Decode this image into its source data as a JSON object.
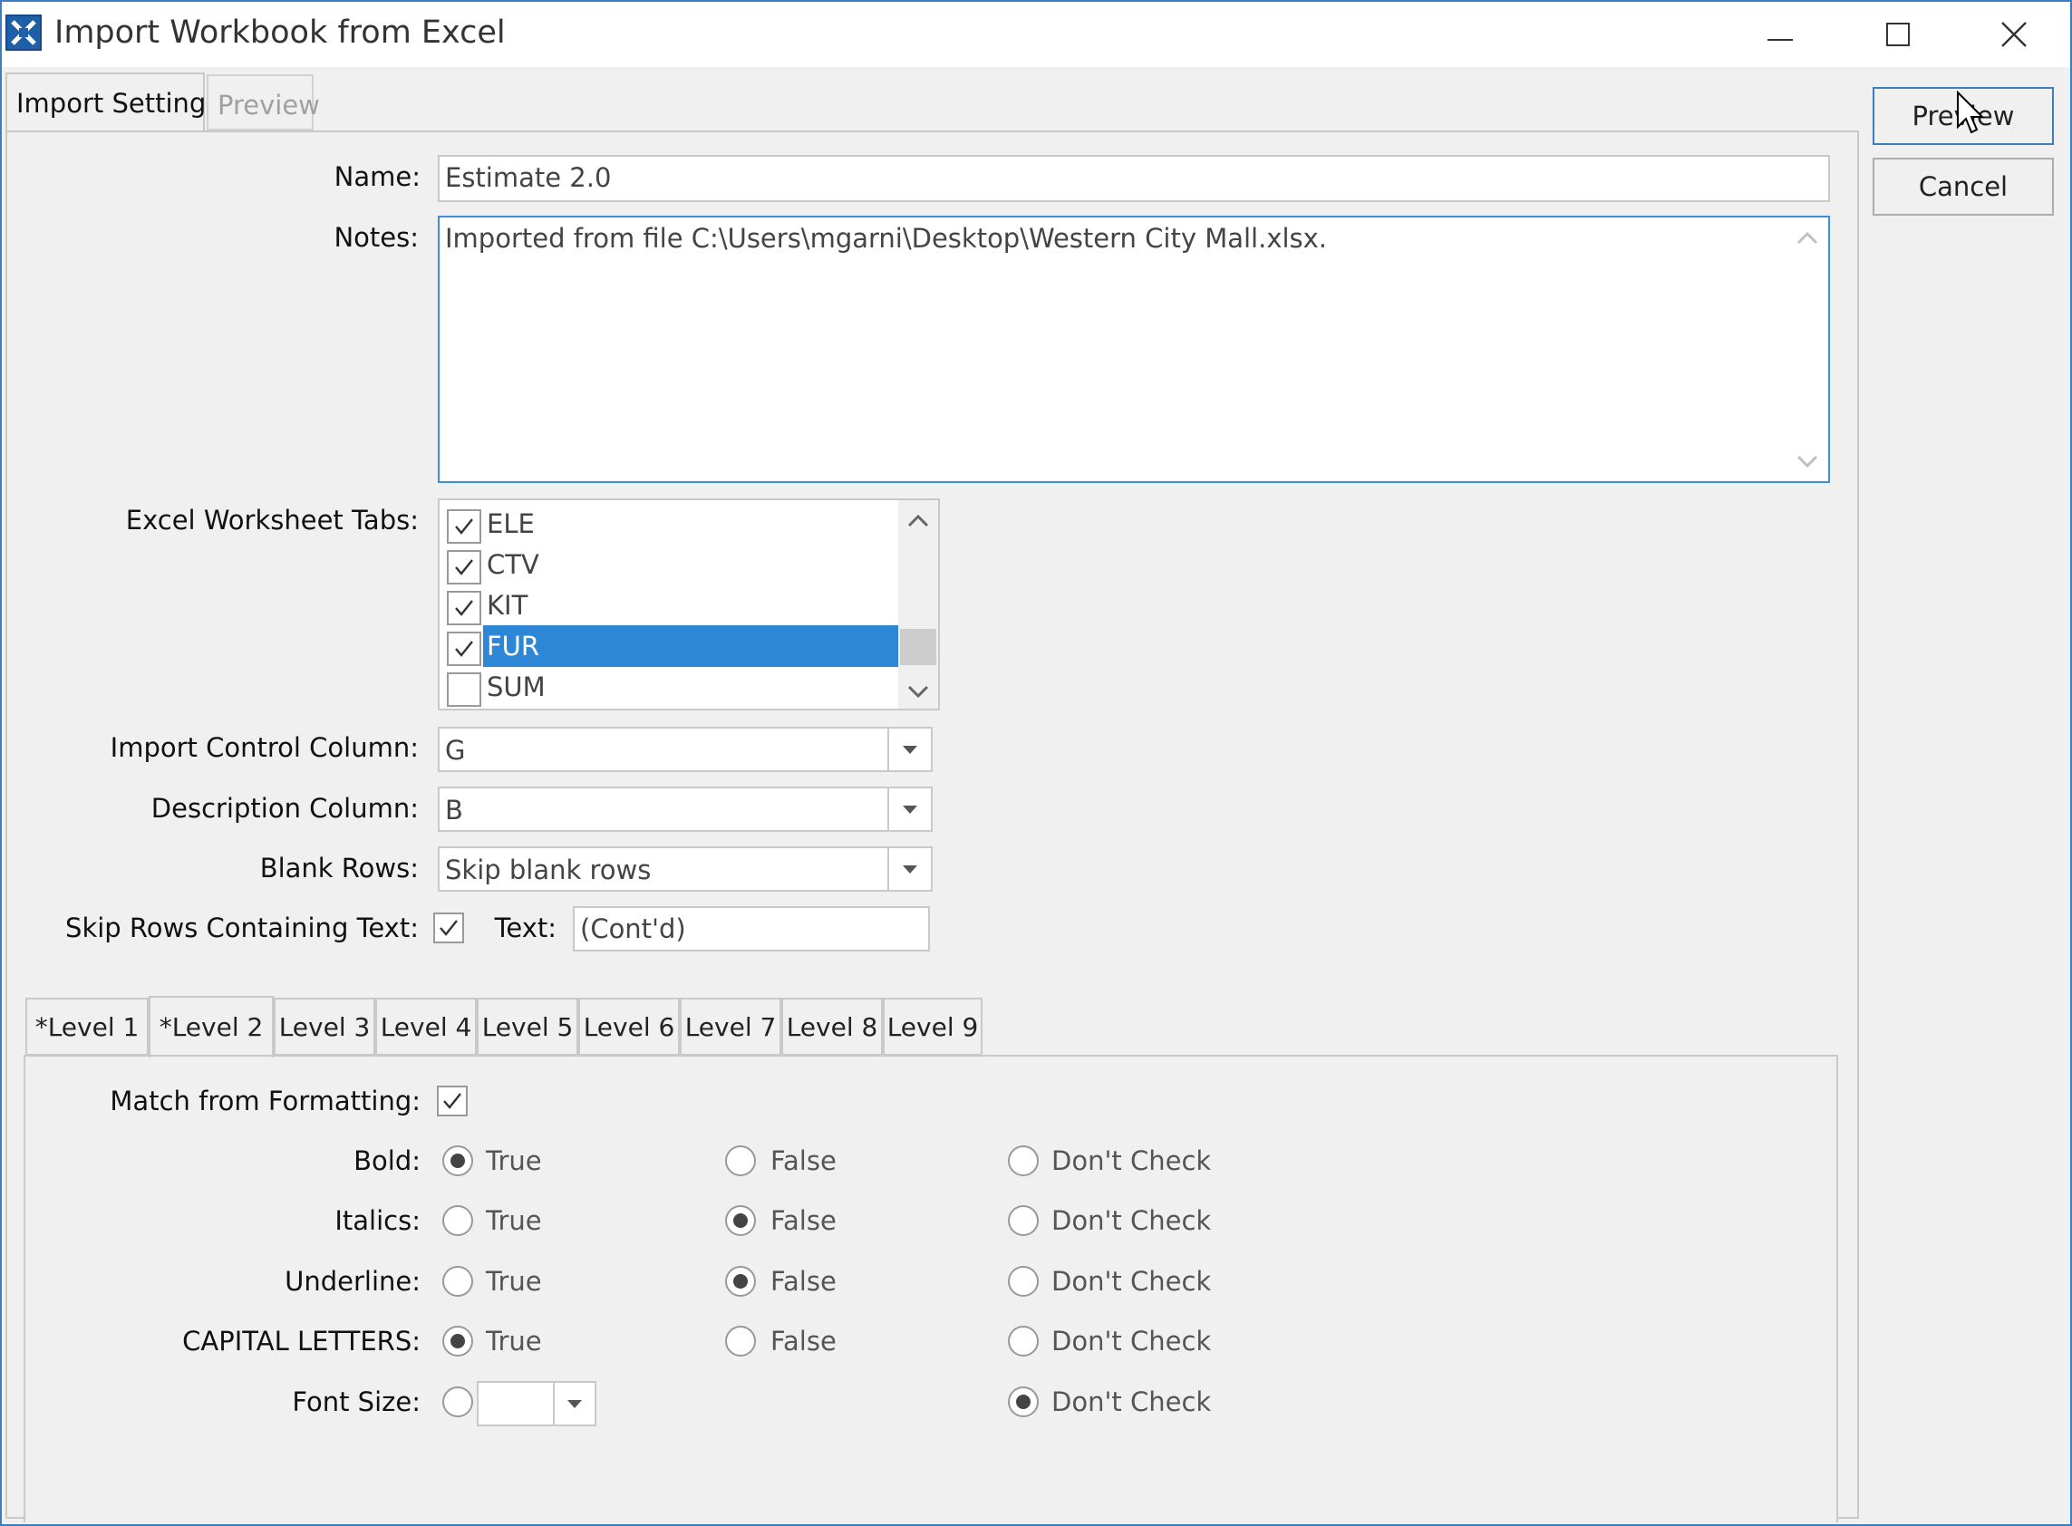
{
  "window": {
    "title": "Import Workbook from Excel"
  },
  "tabs": {
    "settings": "Import Settings",
    "preview": "Preview"
  },
  "buttons": {
    "preview": "Preview",
    "cancel": "Cancel"
  },
  "form": {
    "name_label": "Name:",
    "name_value": "Estimate 2.0",
    "notes_label": "Notes:",
    "notes_value": "Imported from file C:\\Users\\mgarni\\Desktop\\Western City Mall.xlsx.",
    "worksheet_tabs_label": "Excel Worksheet Tabs:",
    "worksheet_tabs": [
      {
        "name": "ELE",
        "checked": true,
        "selected": false
      },
      {
        "name": "CTV",
        "checked": true,
        "selected": false
      },
      {
        "name": "KIT",
        "checked": true,
        "selected": false
      },
      {
        "name": "FUR",
        "checked": true,
        "selected": true
      },
      {
        "name": "SUM",
        "checked": false,
        "selected": false
      }
    ],
    "import_control_label": "Import Control Column:",
    "import_control_value": "G",
    "description_label": "Description Column:",
    "description_value": "B",
    "blank_rows_label": "Blank Rows:",
    "blank_rows_value": "Skip blank rows",
    "skip_rows_label": "Skip Rows Containing Text:",
    "skip_rows_checked": true,
    "text_label": "Text:",
    "text_value": "(Cont'd)"
  },
  "level_tabs": [
    "*Level 1",
    "*Level 2",
    "Level 3",
    "Level 4",
    "Level 5",
    "Level 6",
    "Level 7",
    "Level 8",
    "Level 9"
  ],
  "active_level_tab": 1,
  "level": {
    "match_label": "Match from Formatting:",
    "match_checked": true,
    "option_true": "True",
    "option_false": "False",
    "option_dont_check": "Don't Check",
    "bold_label": "Bold:",
    "bold_selected": "true",
    "italics_label": "Italics:",
    "italics_selected": "false",
    "underline_label": "Underline:",
    "underline_selected": "false",
    "capitals_label": "CAPITAL LETTERS:",
    "capitals_selected": "true",
    "font_size_label": "Font Size:",
    "font_size_value": "",
    "font_size_selected": "dont_check"
  },
  "colors": {
    "accent": "#3c7fc1",
    "selection": "#2e86d6"
  }
}
